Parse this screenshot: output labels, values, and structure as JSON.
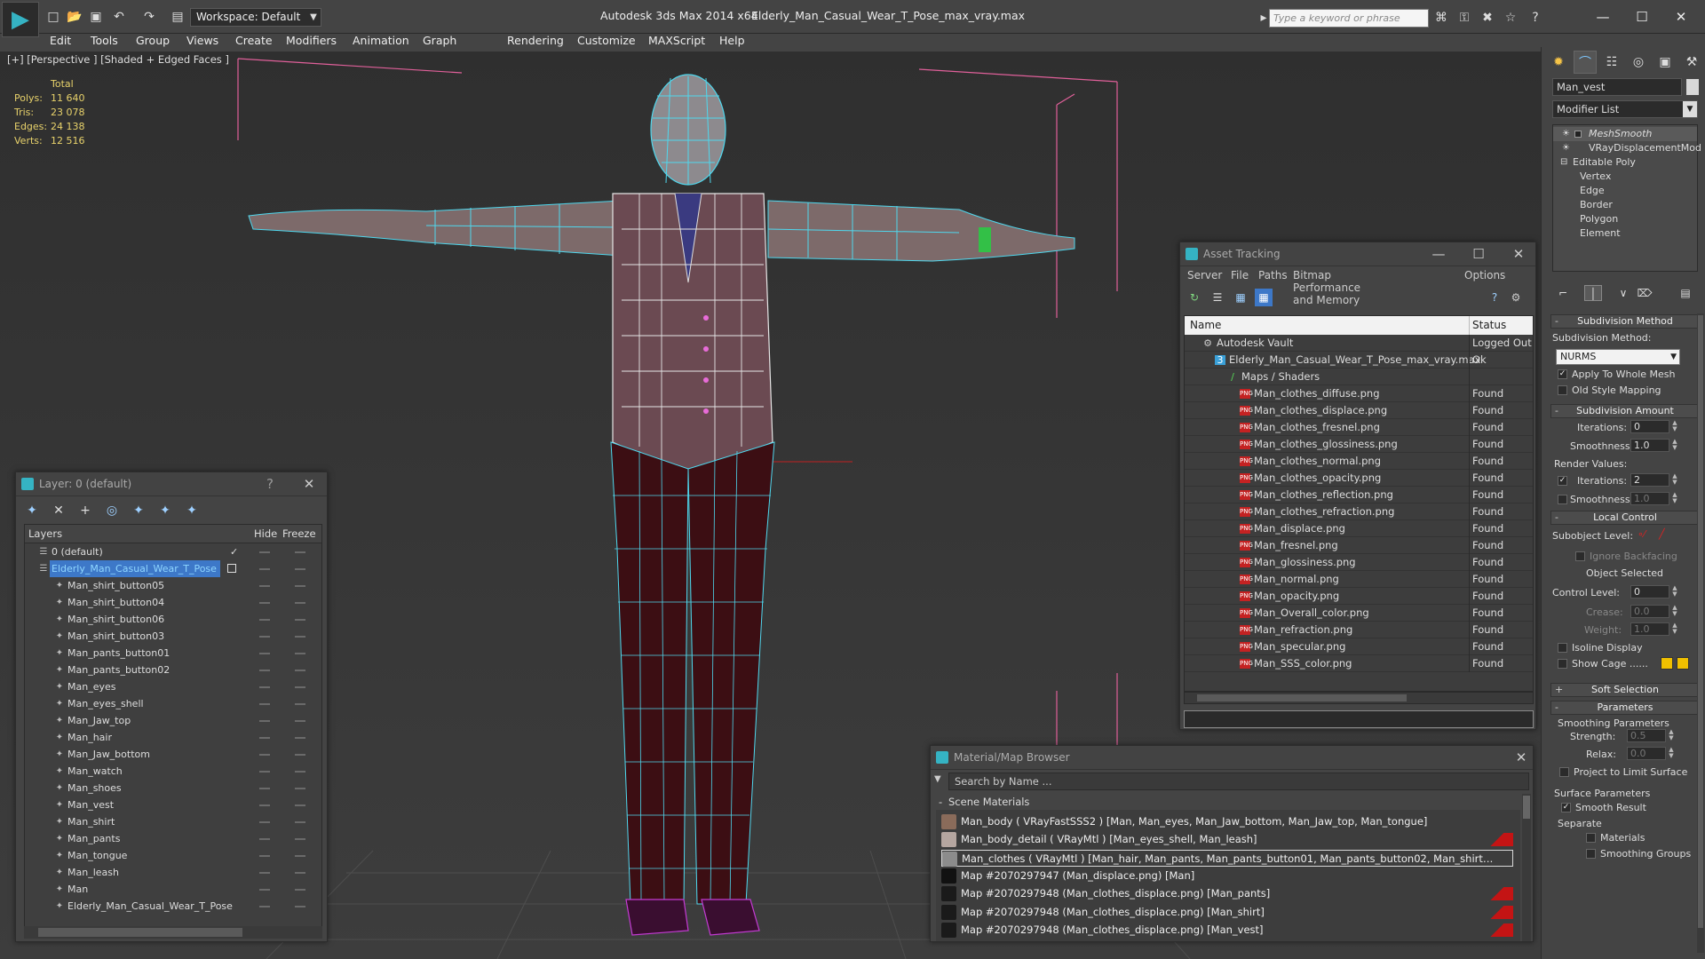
{
  "titlebar": {
    "workspace": "Workspace: Default",
    "app_title": "Autodesk 3ds Max  2014 x64",
    "doc_title": "Elderly_Man_Casual_Wear_T_Pose_max_vray.max",
    "search_placeholder": "Type a keyword or phrase",
    "minimize": "—",
    "maximize": "☐",
    "close": "✕"
  },
  "menu": [
    "Edit",
    "Tools",
    "Group",
    "Views",
    "Create",
    "Modifiers",
    "Animation",
    "Graph Editors",
    "Rendering",
    "Customize",
    "MAXScript",
    "Help"
  ],
  "viewport": {
    "label": "[+] [Perspective ] [Shaded + Edged Faces ]",
    "stats_header": "Total",
    "stats": [
      {
        "key": "Polys:",
        "value": "11 640"
      },
      {
        "key": "Tris:",
        "value": "23 078"
      },
      {
        "key": "Edges:",
        "value": "24 138"
      },
      {
        "key": "Verts:",
        "value": "12 516"
      }
    ],
    "stats_color": "#e8d26b",
    "wire_color": "#4fd8ee",
    "bbox_color": "#e0609a"
  },
  "layer_panel": {
    "title": "Layer: 0 (default)",
    "help": "?",
    "close": "✕",
    "col_layers": "Layers",
    "col_hide": "Hide",
    "col_freeze": "Freeze",
    "layers": [
      {
        "name": "0 (default)",
        "indent": 0,
        "checked": true,
        "selected": false
      },
      {
        "name": "Elderly_Man_Casual_Wear_T_Pose",
        "indent": 0,
        "checked": false,
        "selected": true
      },
      {
        "name": "Man_shirt_button05",
        "indent": 1
      },
      {
        "name": "Man_shirt_button04",
        "indent": 1
      },
      {
        "name": "Man_shirt_button06",
        "indent": 1
      },
      {
        "name": "Man_shirt_button03",
        "indent": 1
      },
      {
        "name": "Man_pants_button01",
        "indent": 1
      },
      {
        "name": "Man_pants_button02",
        "indent": 1
      },
      {
        "name": "Man_eyes",
        "indent": 1
      },
      {
        "name": "Man_eyes_shell",
        "indent": 1
      },
      {
        "name": "Man_Jaw_top",
        "indent": 1
      },
      {
        "name": "Man_hair",
        "indent": 1
      },
      {
        "name": "Man_Jaw_bottom",
        "indent": 1
      },
      {
        "name": "Man_watch",
        "indent": 1
      },
      {
        "name": "Man_shoes",
        "indent": 1
      },
      {
        "name": "Man_vest",
        "indent": 1
      },
      {
        "name": "Man_shirt",
        "indent": 1
      },
      {
        "name": "Man_pants",
        "indent": 1
      },
      {
        "name": "Man_tongue",
        "indent": 1
      },
      {
        "name": "Man_leash",
        "indent": 1
      },
      {
        "name": "Man",
        "indent": 1
      },
      {
        "name": "Elderly_Man_Casual_Wear_T_Pose",
        "indent": 1
      }
    ]
  },
  "asset_panel": {
    "title": "Asset Tracking",
    "menu": [
      "Server",
      "File",
      "Paths",
      "Bitmap Performance and Memory",
      "Options"
    ],
    "col_name": "Name",
    "col_status": "Status",
    "rows": [
      {
        "name": "Autodesk Vault",
        "status": "Logged Out",
        "indent": 1,
        "icon": "vault"
      },
      {
        "name": "Elderly_Man_Casual_Wear_T_Pose_max_vray.max",
        "status": "Ok",
        "indent": 2,
        "icon": "max"
      },
      {
        "name": "Maps / Shaders",
        "status": "",
        "indent": 3,
        "icon": "maps"
      },
      {
        "name": "Man_clothes_diffuse.png",
        "status": "Found",
        "indent": 4,
        "icon": "png"
      },
      {
        "name": "Man_clothes_displace.png",
        "status": "Found",
        "indent": 4,
        "icon": "png"
      },
      {
        "name": "Man_clothes_fresnel.png",
        "status": "Found",
        "indent": 4,
        "icon": "png"
      },
      {
        "name": "Man_clothes_glossiness.png",
        "status": "Found",
        "indent": 4,
        "icon": "png"
      },
      {
        "name": "Man_clothes_normal.png",
        "status": "Found",
        "indent": 4,
        "icon": "png"
      },
      {
        "name": "Man_clothes_opacity.png",
        "status": "Found",
        "indent": 4,
        "icon": "png"
      },
      {
        "name": "Man_clothes_reflection.png",
        "status": "Found",
        "indent": 4,
        "icon": "png"
      },
      {
        "name": "Man_clothes_refraction.png",
        "status": "Found",
        "indent": 4,
        "icon": "png"
      },
      {
        "name": "Man_displace.png",
        "status": "Found",
        "indent": 4,
        "icon": "png"
      },
      {
        "name": "Man_fresnel.png",
        "status": "Found",
        "indent": 4,
        "icon": "png"
      },
      {
        "name": "Man_glossiness.png",
        "status": "Found",
        "indent": 4,
        "icon": "png"
      },
      {
        "name": "Man_normal.png",
        "status": "Found",
        "indent": 4,
        "icon": "png"
      },
      {
        "name": "Man_opacity.png",
        "status": "Found",
        "indent": 4,
        "icon": "png"
      },
      {
        "name": "Man_Overall_color.png",
        "status": "Found",
        "indent": 4,
        "icon": "png"
      },
      {
        "name": "Man_refraction.png",
        "status": "Found",
        "indent": 4,
        "icon": "png"
      },
      {
        "name": "Man_specular.png",
        "status": "Found",
        "indent": 4,
        "icon": "png"
      },
      {
        "name": "Man_SSS_color.png",
        "status": "Found",
        "indent": 4,
        "icon": "png"
      }
    ]
  },
  "material_browser": {
    "title": "Material/Map Browser",
    "search_placeholder": "Search by Name ...",
    "section": "Scene Materials",
    "rows": [
      {
        "text": "Man_body  ( VRayFastSSS2 ) [Man, Man_eyes, Man_Jaw_bottom, Man_Jaw_top, Man_tongue]",
        "flag": false,
        "highlight": false
      },
      {
        "text": "Man_body_detail  ( VRayMtl ) [Man_eyes_shell, Man_leash]",
        "flag": true,
        "highlight": false
      },
      {
        "text": "Man_clothes  ( VRayMtl ) [Man_hair, Man_pants, Man_pants_button01, Man_pants_button02, Man_shirt, Man_shirt_but...",
        "flag": false,
        "highlight": true
      },
      {
        "text": "Map #2070297947 (Man_displace.png) [Man]",
        "flag": false,
        "highlight": false
      },
      {
        "text": "Map #2070297948 (Man_clothes_displace.png) [Man_pants]",
        "flag": true,
        "highlight": false
      },
      {
        "text": "Map #2070297948 (Man_clothes_displace.png) [Man_shirt]",
        "flag": true,
        "highlight": false
      },
      {
        "text": "Map #2070297948 (Man_clothes_displace.png) [Man_vest]",
        "flag": true,
        "highlight": false
      }
    ]
  },
  "command_panel": {
    "object_name": "Man_vest",
    "modifier_list": "Modifier List",
    "stack": [
      {
        "label": "MeshSmooth",
        "indent": 0,
        "italic": true,
        "selected": true
      },
      {
        "label": "VRayDisplacementMod",
        "indent": 0,
        "italic": false,
        "selected": false
      },
      {
        "label": "Editable Poly",
        "indent": 0,
        "italic": false,
        "selected": false
      },
      {
        "label": "Vertex",
        "indent": 2
      },
      {
        "label": "Edge",
        "indent": 2
      },
      {
        "label": "Border",
        "indent": 2
      },
      {
        "label": "Polygon",
        "indent": 2
      },
      {
        "label": "Element",
        "indent": 2
      }
    ],
    "subdiv_method_title": "Subdivision Method",
    "subdiv_method_label": "Subdivision Method:",
    "subdiv_method_value": "NURMS",
    "apply_whole_mesh": "Apply To Whole Mesh",
    "old_style_mapping": "Old Style Mapping",
    "subdiv_amount_title": "Subdivision Amount",
    "iterations_label": "Iterations:",
    "iterations_value": "0",
    "smoothness_label": "Smoothness:",
    "smoothness_value": "1.0",
    "render_values": "Render Values:",
    "render_iterations_label": "Iterations:",
    "render_iterations_value": "2",
    "render_smoothness_label": "Smoothness:",
    "render_smoothness_value": "1.0",
    "local_control_title": "Local Control",
    "subobject_level": "Subobject Level:",
    "ignore_backfacing": "Ignore Backfacing",
    "object_selected": "Object Selected",
    "control_level_label": "Control Level:",
    "control_level_value": "0",
    "crease_label": "Crease:",
    "crease_value": "0.0",
    "weight_label": "Weight:",
    "weight_value": "1.0",
    "isoline_display": "Isoline Display",
    "show_cage": "Show Cage ......",
    "soft_selection_title": "Soft Selection",
    "parameters_title": "Parameters",
    "smoothing_params": "Smoothing Parameters",
    "strength_label": "Strength:",
    "strength_value": "0.5",
    "relax_label": "Relax:",
    "relax_value": "0.0",
    "project_limit": "Project to Limit Surface",
    "surface_params": "Surface Parameters",
    "smooth_result": "Smooth Result",
    "separate": "Separate",
    "materials": "Materials",
    "smoothing_groups": "Smoothing Groups",
    "cage_color": "#f0c000"
  }
}
